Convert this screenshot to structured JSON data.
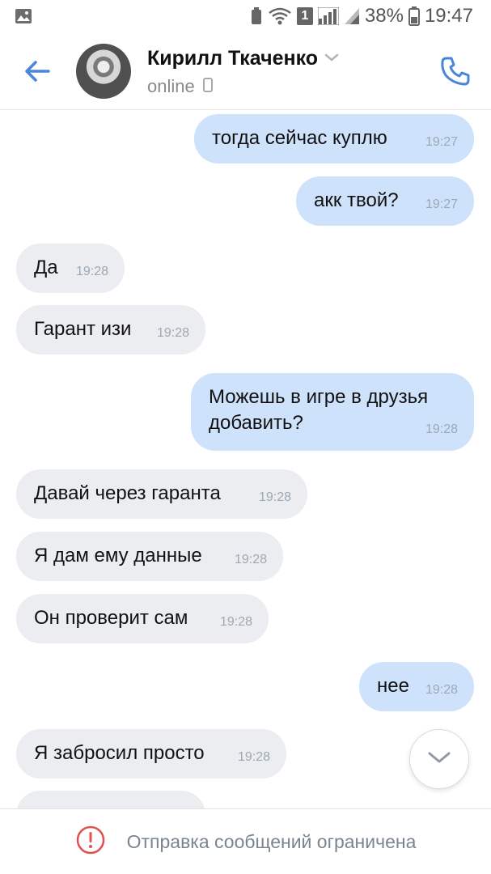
{
  "status_bar": {
    "battery_percent": "38%",
    "time": "19:47",
    "sim_label": "1",
    "icons": [
      "image-icon",
      "recycle-icon",
      "wifi-icon",
      "sim-icon",
      "signal-icon",
      "signal-icon",
      "battery-icon"
    ]
  },
  "header": {
    "contact_name": "Кирилл Ткаченко",
    "status": "online",
    "icons": [
      "back-arrow-icon",
      "avatar",
      "chevron-down-icon",
      "phone-small-icon",
      "call-icon"
    ],
    "accent_color": "#4a86d8"
  },
  "messages": [
    {
      "direction": "out",
      "text": "тогда сейчас куплю",
      "time": "19:27"
    },
    {
      "direction": "out",
      "text": "акк твой?",
      "time": "19:27"
    },
    {
      "direction": "in",
      "text": "Да",
      "time": "19:28"
    },
    {
      "direction": "in",
      "text": "Гарант изи",
      "time": "19:28"
    },
    {
      "direction": "out",
      "text": "Можешь в игре в друзья добавить?",
      "time": "19:28"
    },
    {
      "direction": "in",
      "text": "Давай через гаранта",
      "time": "19:28"
    },
    {
      "direction": "in",
      "text": "Я дам ему данные",
      "time": "19:28"
    },
    {
      "direction": "in",
      "text": "Он проверит сам",
      "time": "19:28"
    },
    {
      "direction": "out",
      "text": "нее",
      "time": "19:28"
    },
    {
      "direction": "in",
      "text": "Я забросил просто",
      "time": "19:28"
    }
  ],
  "footer": {
    "notice": "Отправка сообщений ограничена",
    "icon": "exclamation-circle-icon",
    "icon_color": "#e05252"
  },
  "colors": {
    "outgoing_bubble": "#cfe2fb",
    "incoming_bubble": "#ebedf0",
    "time_text": "#9da8b5"
  }
}
